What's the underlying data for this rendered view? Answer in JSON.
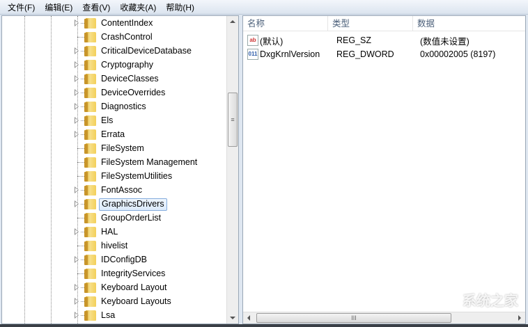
{
  "menu": [
    "文件(F)",
    "编辑(E)",
    "查看(V)",
    "收藏夹(A)",
    "帮助(H)"
  ],
  "tree": [
    {
      "label": "ContentIndex",
      "expandable": true
    },
    {
      "label": "CrashControl",
      "expandable": false
    },
    {
      "label": "CriticalDeviceDatabase",
      "expandable": true
    },
    {
      "label": "Cryptography",
      "expandable": true
    },
    {
      "label": "DeviceClasses",
      "expandable": true
    },
    {
      "label": "DeviceOverrides",
      "expandable": true
    },
    {
      "label": "Diagnostics",
      "expandable": true
    },
    {
      "label": "Els",
      "expandable": true
    },
    {
      "label": "Errata",
      "expandable": true
    },
    {
      "label": "FileSystem",
      "expandable": false
    },
    {
      "label": "FileSystem Management",
      "expandable": false
    },
    {
      "label": "FileSystemUtilities",
      "expandable": false
    },
    {
      "label": "FontAssoc",
      "expandable": true
    },
    {
      "label": "GraphicsDrivers",
      "expandable": true,
      "selected": true
    },
    {
      "label": "GroupOrderList",
      "expandable": false
    },
    {
      "label": "HAL",
      "expandable": true
    },
    {
      "label": "hivelist",
      "expandable": false
    },
    {
      "label": "IDConfigDB",
      "expandable": true
    },
    {
      "label": "IntegrityServices",
      "expandable": false
    },
    {
      "label": "Keyboard Layout",
      "expandable": true
    },
    {
      "label": "Keyboard Layouts",
      "expandable": true
    },
    {
      "label": "Lsa",
      "expandable": true
    }
  ],
  "columns": {
    "name": "名称",
    "type": "类型",
    "data": "数据"
  },
  "values": [
    {
      "icon": "string-value-icon",
      "glyph": "ab",
      "name": "(默认)",
      "type": "REG_SZ",
      "data": "(数值未设置)"
    },
    {
      "icon": "binary-value-icon",
      "glyph": "011",
      "name": "DxgKrnlVersion",
      "type": "REG_DWORD",
      "data": "0x00002005 (8197)"
    }
  ],
  "watermark": "系统之家",
  "scroll_thumb_glyph": "≡",
  "hscroll_thumb_glyph": "III"
}
